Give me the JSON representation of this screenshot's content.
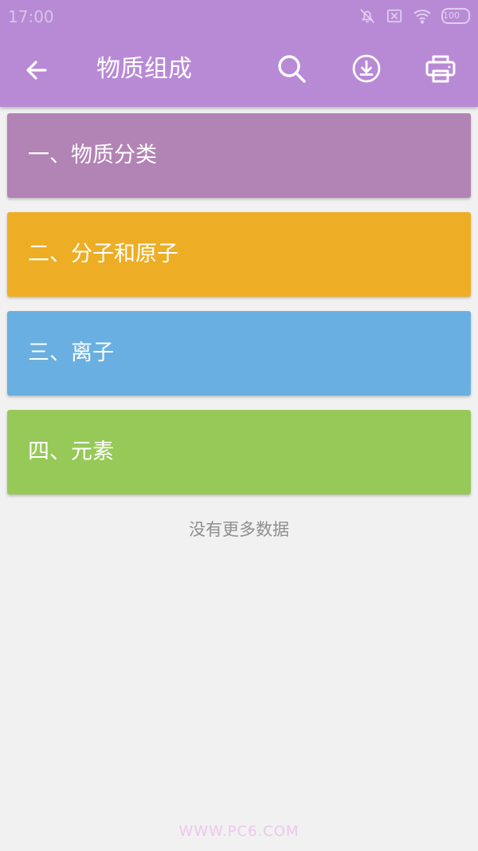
{
  "status_bar": {
    "time": "17:00",
    "battery": "100",
    "icons": [
      "mute-notifications-icon",
      "sim-off-icon",
      "wifi-icon",
      "battery-icon"
    ]
  },
  "toolbar": {
    "title": "物质组成",
    "icons": [
      "back-arrow-icon",
      "search-icon",
      "download-icon",
      "print-icon"
    ]
  },
  "list": {
    "items": [
      {
        "label": "一、物质分类",
        "color": "#b283b5"
      },
      {
        "label": "二、分子和原子",
        "color": "#edae25"
      },
      {
        "label": "三、离子",
        "color": "#6aafe1"
      },
      {
        "label": "四、元素",
        "color": "#96c957"
      }
    ],
    "end_text": "没有更多数据"
  },
  "colors": {
    "appbar": "#b88ad5",
    "background": "#f1f1f1"
  },
  "watermark": "WWW.PC6.COM"
}
